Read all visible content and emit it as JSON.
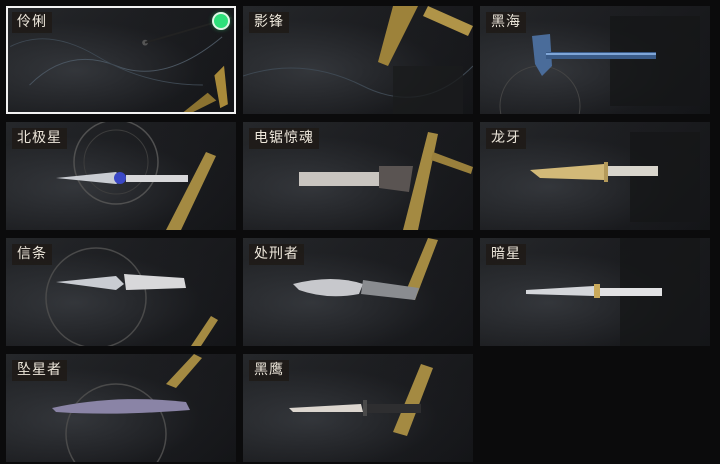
{
  "colors": {
    "selected_border": "#f2f2f2",
    "equipped_indicator": "#2ee07a",
    "label_text": "#ece6da"
  },
  "knives": [
    {
      "name": "伶俐",
      "selected": true,
      "equipped": true,
      "icon": "empty-slot"
    },
    {
      "name": "影锋",
      "selected": false,
      "equipped": false,
      "icon": "empty-slot"
    },
    {
      "name": "黑海",
      "selected": false,
      "equipped": false,
      "icon": "axe-icon"
    },
    {
      "name": "北极星",
      "selected": false,
      "equipped": false,
      "icon": "knife-icon"
    },
    {
      "name": "电锯惊魂",
      "selected": false,
      "equipped": false,
      "icon": "chainsaw-knife-icon"
    },
    {
      "name": "龙牙",
      "selected": false,
      "equipped": false,
      "icon": "bayonet-icon"
    },
    {
      "name": "信条",
      "selected": false,
      "equipped": false,
      "icon": "karambit-knife-icon"
    },
    {
      "name": "处刑者",
      "selected": false,
      "equipped": false,
      "icon": "serrated-knife-icon"
    },
    {
      "name": "暗星",
      "selected": false,
      "equipped": false,
      "icon": "dagger-icon"
    },
    {
      "name": "坠星者",
      "selected": false,
      "equipped": false,
      "icon": "dagger-icon"
    },
    {
      "name": "黑鹰",
      "selected": false,
      "equipped": false,
      "icon": "combat-knife-icon"
    }
  ]
}
